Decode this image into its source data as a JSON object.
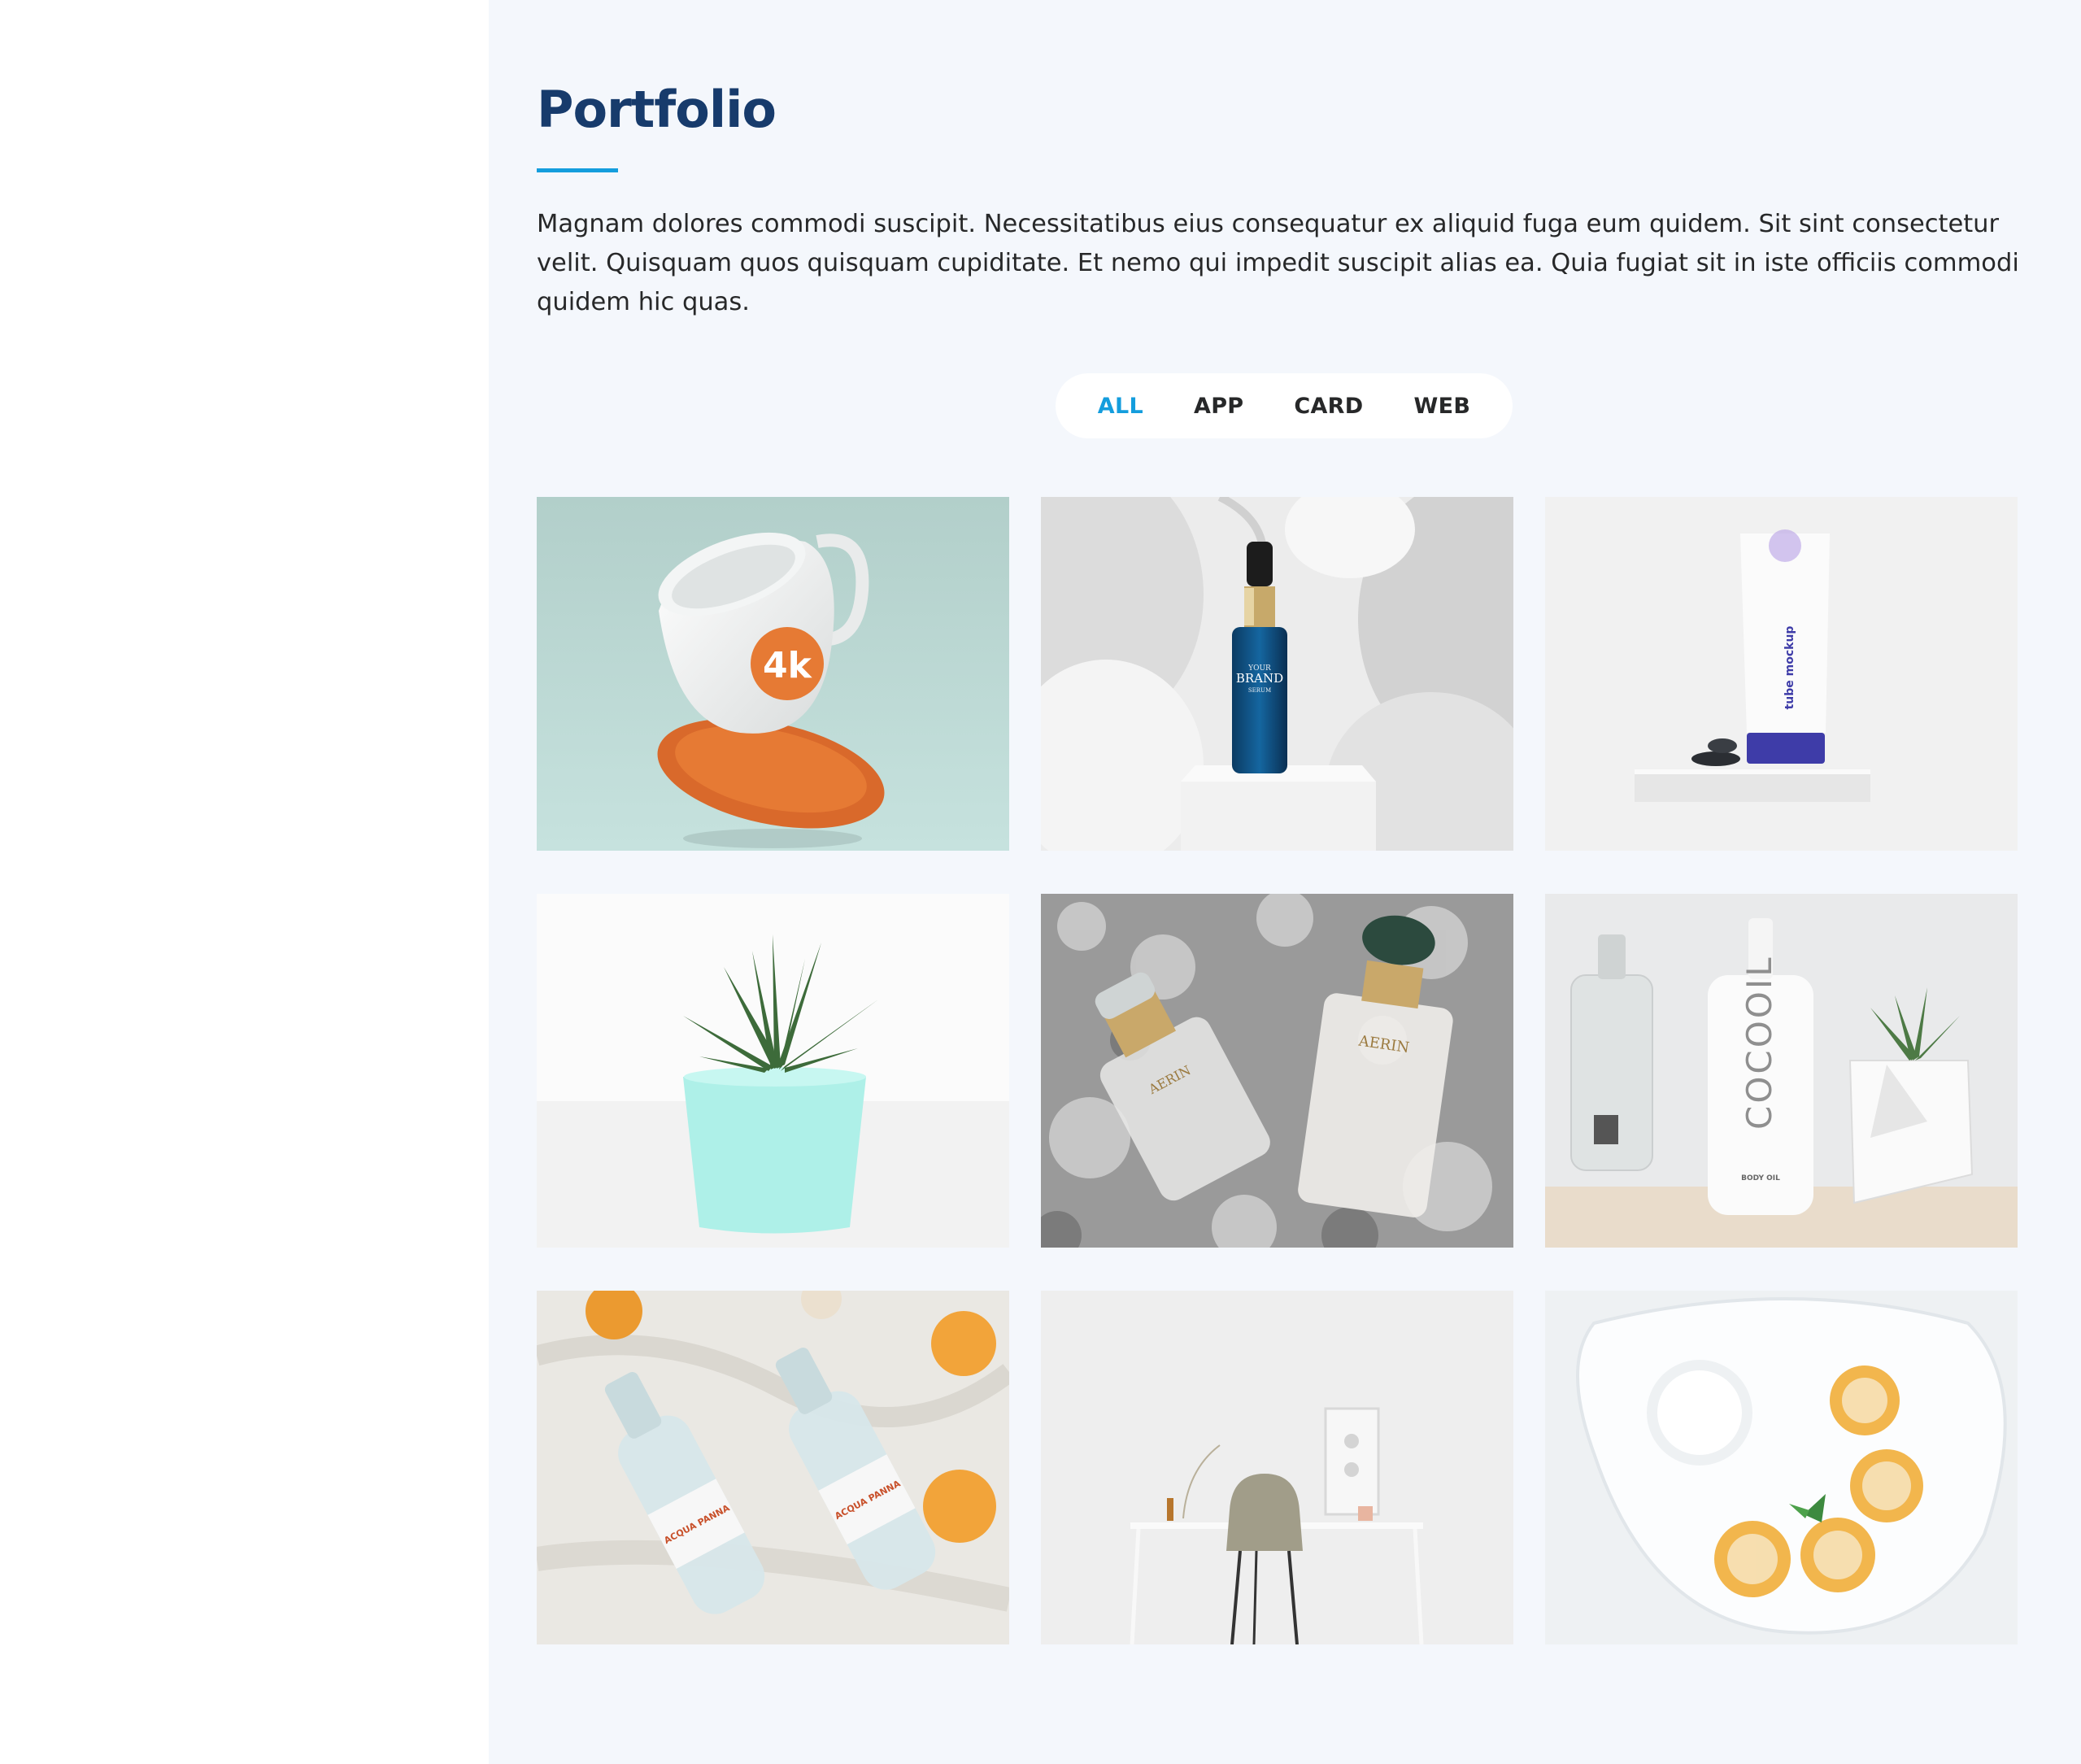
{
  "portfolio": {
    "title": "Portfolio",
    "description": "Magnam dolores commodi suscipit. Necessitatibus eius consequatur ex aliquid fuga eum quidem. Sit sint consectetur velit. Quisquam quos quisquam cupiditate. Et nemo qui impedit suscipit alias ea. Quia fugiat sit in iste officiis commodi quidem hic quas.",
    "accent_color": "#149ddd",
    "title_color": "#173b6c",
    "filters": [
      {
        "label": "ALL",
        "active": true
      },
      {
        "label": "APP",
        "active": false
      },
      {
        "label": "CARD",
        "active": false
      },
      {
        "label": "WEB",
        "active": false
      }
    ],
    "items": [
      {
        "image": "mug-mockup-image",
        "mug_logo": "4k"
      },
      {
        "image": "serum-bottle-image",
        "bottle_line1": "YOUR",
        "bottle_line2": "BRAND",
        "bottle_line3": "SERUM"
      },
      {
        "image": "tube-mockup-image",
        "tube_text": "tube mockup"
      },
      {
        "image": "succulent-pot-image"
      },
      {
        "image": "perfume-bottles-image",
        "perfume_brand": "AERIN"
      },
      {
        "image": "cocooil-bottle-image",
        "bottle_brand": "COCOOIL",
        "bottle_sub": "BODY OIL"
      },
      {
        "image": "water-bottles-image",
        "bottle_brand": "ACQUA PANNA"
      },
      {
        "image": "desk-chair-image"
      },
      {
        "image": "pancakes-plate-image"
      }
    ]
  }
}
